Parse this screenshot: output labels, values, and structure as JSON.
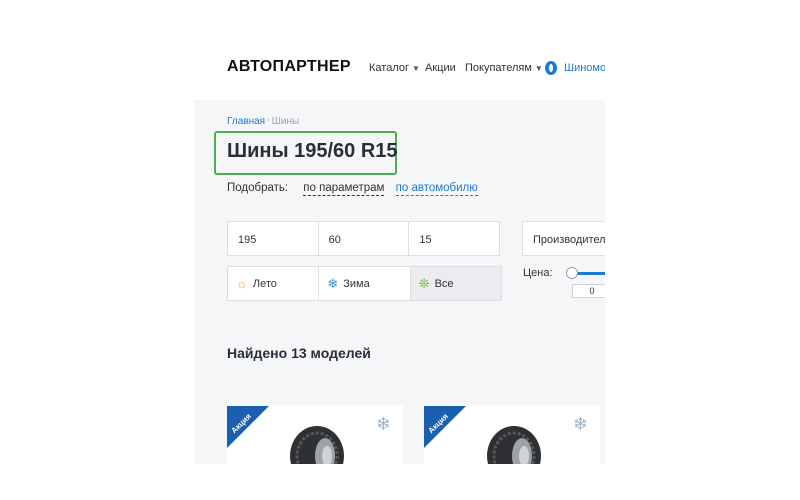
{
  "header": {
    "logo": "АВТОПАРТНЕР",
    "nav": [
      {
        "label": "Каталог",
        "has_caret": true
      },
      {
        "label": "Акции",
        "has_caret": false
      },
      {
        "label": "Покупателям",
        "has_caret": true
      },
      {
        "label": "Шиномо",
        "icon": "tire-icon"
      }
    ]
  },
  "breadcrumb": {
    "home": "Главная",
    "current": "Шины"
  },
  "page": {
    "title": "Шины 195/60 R15",
    "pick_label": "Подобрать:",
    "pick_by_params": "по параметрам",
    "pick_by_car": "по автомобилю"
  },
  "filters": {
    "width": "195",
    "profile": "60",
    "diameter": "15",
    "seasons": [
      {
        "label": "Лето",
        "icon": "sun-icon"
      },
      {
        "label": "Зима",
        "icon": "snowflake-icon"
      },
      {
        "label": "Все",
        "icon": "all-season-icon",
        "selected": true
      }
    ],
    "manufacturer_placeholder": "Производитель",
    "price_label": "Цена:",
    "price_min": "0"
  },
  "results": {
    "found_text": "Найдено 13 моделей",
    "cards": [
      {
        "badge": "Акция",
        "season_icon": "snowflake-icon"
      },
      {
        "badge": "Акция",
        "season_icon": "snowflake-icon"
      }
    ]
  },
  "colors": {
    "accent": "#1f7ad1",
    "ribbon": "#1b5fb0",
    "highlight": "#4cae4c"
  }
}
